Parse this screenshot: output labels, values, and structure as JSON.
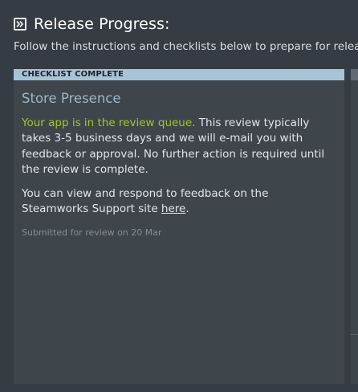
{
  "header": {
    "icon": "double-chevron-right-icon",
    "title": "Release Progress:",
    "subtitle": "Follow the instructions and checklists below to prepare for release"
  },
  "card": {
    "banner": "CHECKLIST COMPLETE",
    "title": "Store Presence",
    "status_highlight": "Your app is in the review queue.",
    "status_text": " This review typically takes 3-5 business days and we will e-mail you with feedback or approval. No further action is required until the review is complete.",
    "feedback_text": "You can view and respond to feedback on the Steamworks Support site ",
    "feedback_link": "here",
    "feedback_end": ".",
    "submitted": "Submitted for review on 20 Mar"
  },
  "colors": {
    "background": "#363c43",
    "card": "#3f464b",
    "banner": "#a7c3d6",
    "title": "#9ab7c9",
    "highlight": "#a2c628"
  }
}
